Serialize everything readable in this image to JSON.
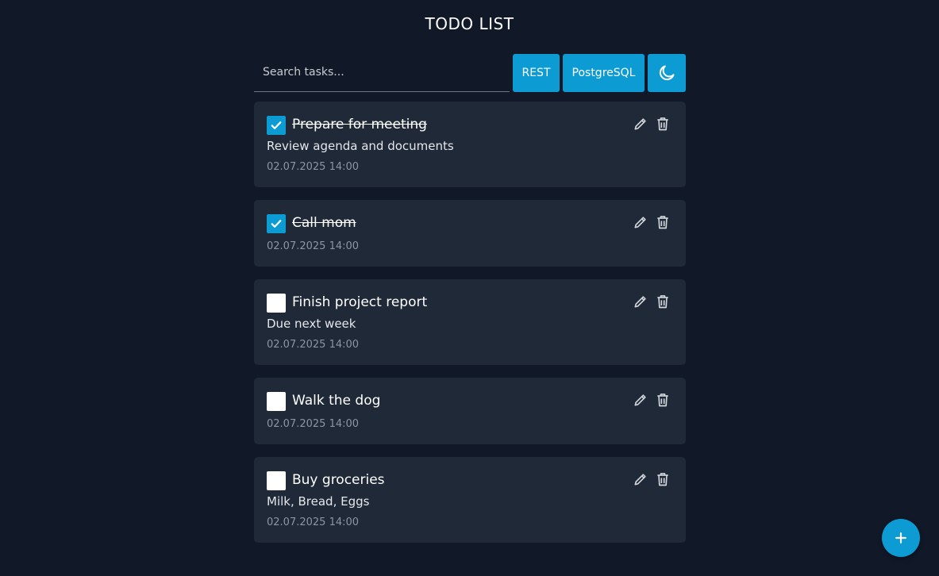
{
  "header": {
    "title": "TODO LIST"
  },
  "toolbar": {
    "search_placeholder": "Search tasks...",
    "search_value": "",
    "rest_label": "REST",
    "db_label": "PostgreSQL",
    "theme_icon": "moon-icon"
  },
  "todos": [
    {
      "title": "Prepare for meeting",
      "description": "Review agenda and documents",
      "date": "02.07.2025 14:00",
      "completed": true
    },
    {
      "title": "Call mom",
      "description": "",
      "date": "02.07.2025 14:00",
      "completed": true
    },
    {
      "title": "Finish project report",
      "description": "Due next week",
      "date": "02.07.2025 14:00",
      "completed": false
    },
    {
      "title": "Walk the dog",
      "description": "",
      "date": "02.07.2025 14:00",
      "completed": false
    },
    {
      "title": "Buy groceries",
      "description": "Milk, Bread, Eggs",
      "date": "02.07.2025 14:00",
      "completed": false
    }
  ],
  "fab": {
    "icon": "plus-icon"
  },
  "colors": {
    "background": "#111827",
    "card": "#1f2937",
    "accent": "#0d9bd3",
    "muted_text": "#8b95a3"
  }
}
